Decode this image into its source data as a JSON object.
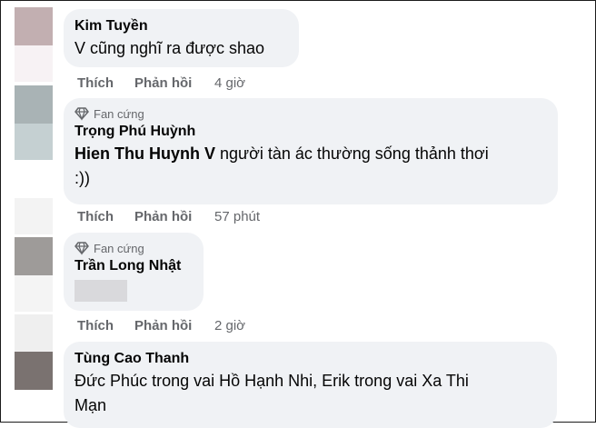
{
  "comments": [
    {
      "author": "Kim Tuyền",
      "text": "V cũng nghĩ ra được shao",
      "like": "Thích",
      "reply": "Phản hồi",
      "time": "4 giờ"
    },
    {
      "badge": "Fan cứng",
      "author": "Trọng Phú Huỳnh",
      "mention": "Hien Thu Huynh V",
      "text": " người tàn ác thường sống thảnh thơi",
      "text2": ":))",
      "like": "Thích",
      "reply": "Phản hồi",
      "time": "57 phút"
    },
    {
      "badge": "Fan cứng",
      "author": "Trần Long Nhật",
      "like": "Thích",
      "reply": "Phản hồi",
      "time": "2 giờ"
    },
    {
      "author": "Tùng Cao Thanh",
      "text": "Đức Phúc trong vai Hồ Hạnh Nhi, Erik trong vai Xa Thi",
      "text2": "Mạn"
    }
  ],
  "icons": {
    "badge": "diamond-icon"
  },
  "colors": {
    "bubble": "#f0f2f5",
    "secondary_text": "#65676b"
  }
}
